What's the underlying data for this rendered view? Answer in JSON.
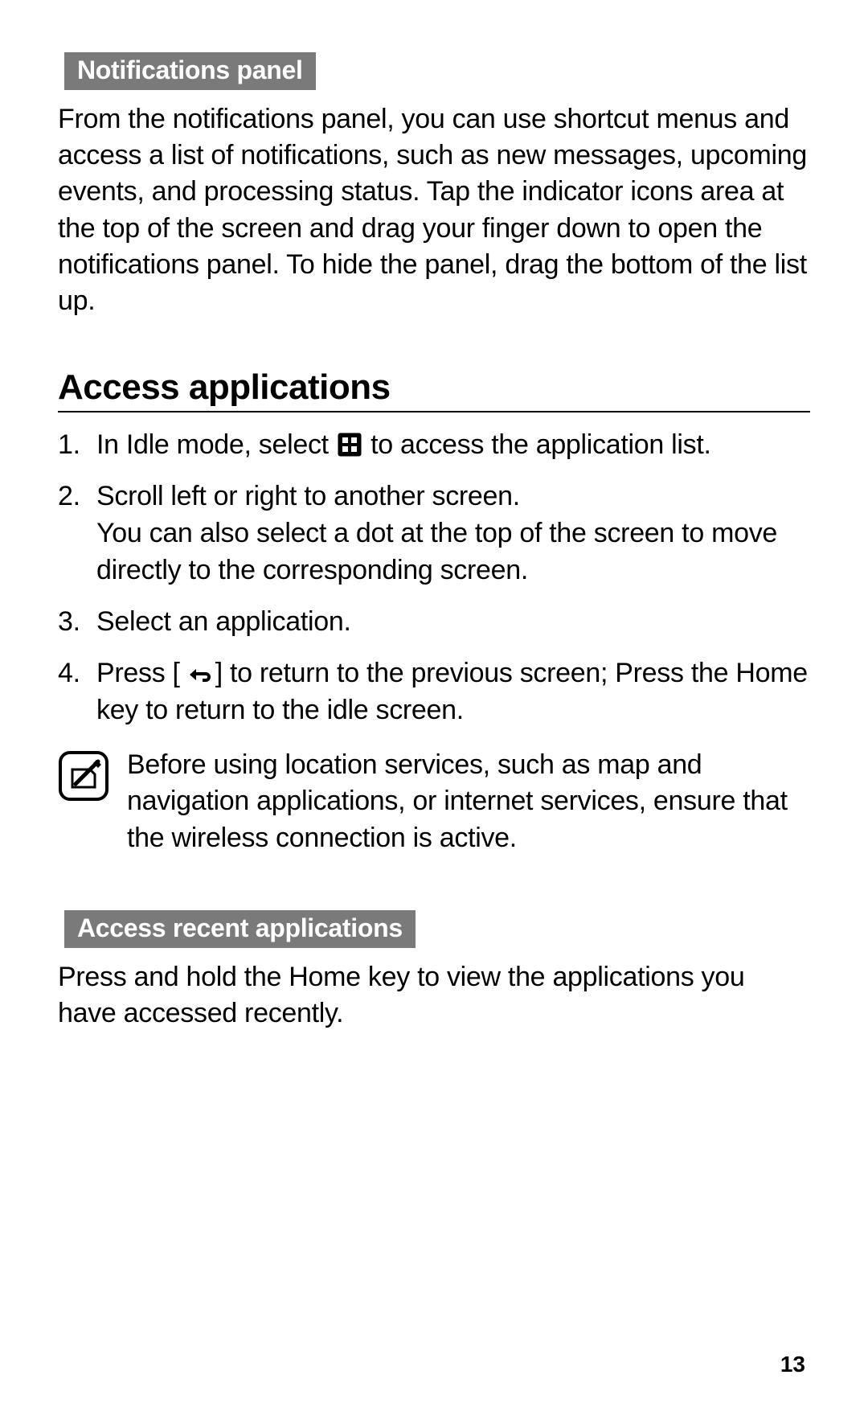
{
  "sub1": {
    "title": "Notifications panel"
  },
  "para1": "From the notifications panel, you can use shortcut menus and access a list of notifications, such as new messages, upcoming events, and processing status. Tap the indicator icons area at the top of the screen and drag your finger down to open the notifications panel. To hide the panel, drag the bottom of the list up.",
  "section": {
    "title": "Access applications"
  },
  "steps": {
    "s1a": "In Idle mode, select ",
    "s1b": " to access the application list.",
    "s2a": "Scroll left or right to another screen.",
    "s2b": "You can also select a dot at the top of the screen to move directly to the corresponding screen.",
    "s3": "Select an application.",
    "s4a": "Press [",
    "s4b": "] to return to the previous screen; Press the Home key to return to the idle screen."
  },
  "note": "Before using location services, such as map and navigation applications, or internet services, ensure that the wireless connection is active.",
  "sub2": {
    "title": "Access recent applications"
  },
  "para2": "Press and hold the Home key to view the applications you have accessed recently.",
  "pagenum": "13"
}
